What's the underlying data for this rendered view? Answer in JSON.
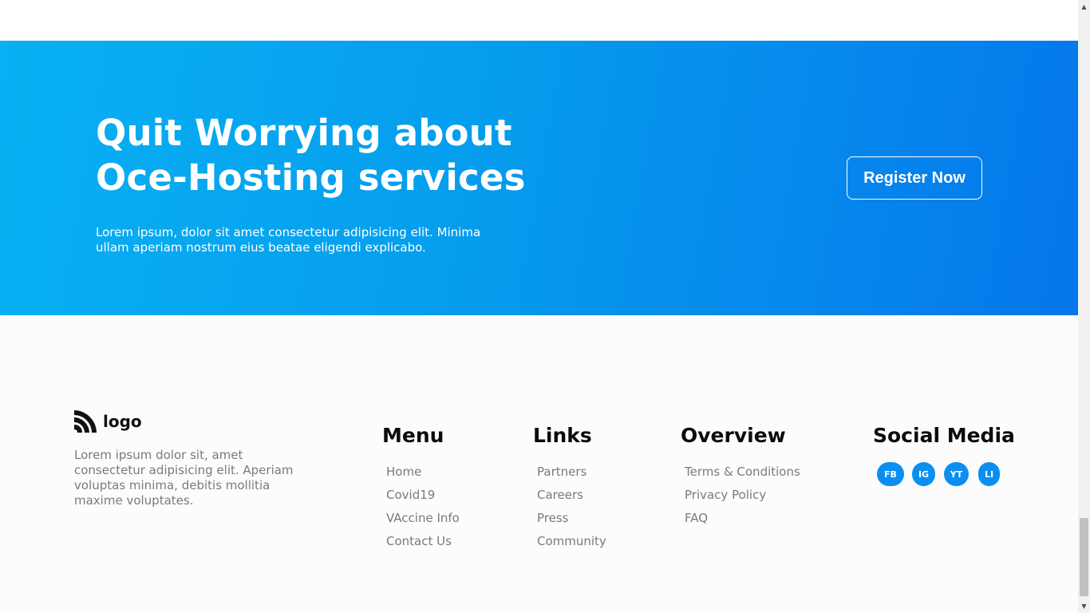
{
  "cta": {
    "title_line1": "Quit Worrying about",
    "title_line2": "Oce-Hosting services",
    "subtitle": "Lorem ipsum, dolor sit amet consectetur adipisicing elit. Minima ullam aperiam nostrum eius beatae eligendi explicabo.",
    "button_label": "Register Now",
    "gradient": [
      "#08b1f3",
      "#0577eb"
    ]
  },
  "footer": {
    "logo_text": "logo",
    "logo_icon": "rss-icon",
    "description": "Lorem ipsum dolor sit, amet consectetur adipisicing elit. Aperiam voluptas minima, debitis mollitia maxime voluptates.",
    "columns": [
      {
        "heading": "Menu",
        "items": [
          "Home",
          "Covid19",
          "VAccine Info",
          "Contact Us"
        ]
      },
      {
        "heading": "Links",
        "items": [
          "Partners",
          "Careers",
          "Press",
          "Community"
        ]
      },
      {
        "heading": "Overview",
        "items": [
          "Terms & Conditions",
          "Privacy Policy",
          "FAQ"
        ]
      }
    ],
    "social": {
      "heading": "Social Media",
      "buttons": [
        "FB",
        "IG",
        "YT",
        "LI"
      ],
      "color": "#0a8ff0"
    }
  },
  "scrollbar": {
    "up_icon": "arrow-up-icon",
    "down_icon": "arrow-down-icon"
  }
}
